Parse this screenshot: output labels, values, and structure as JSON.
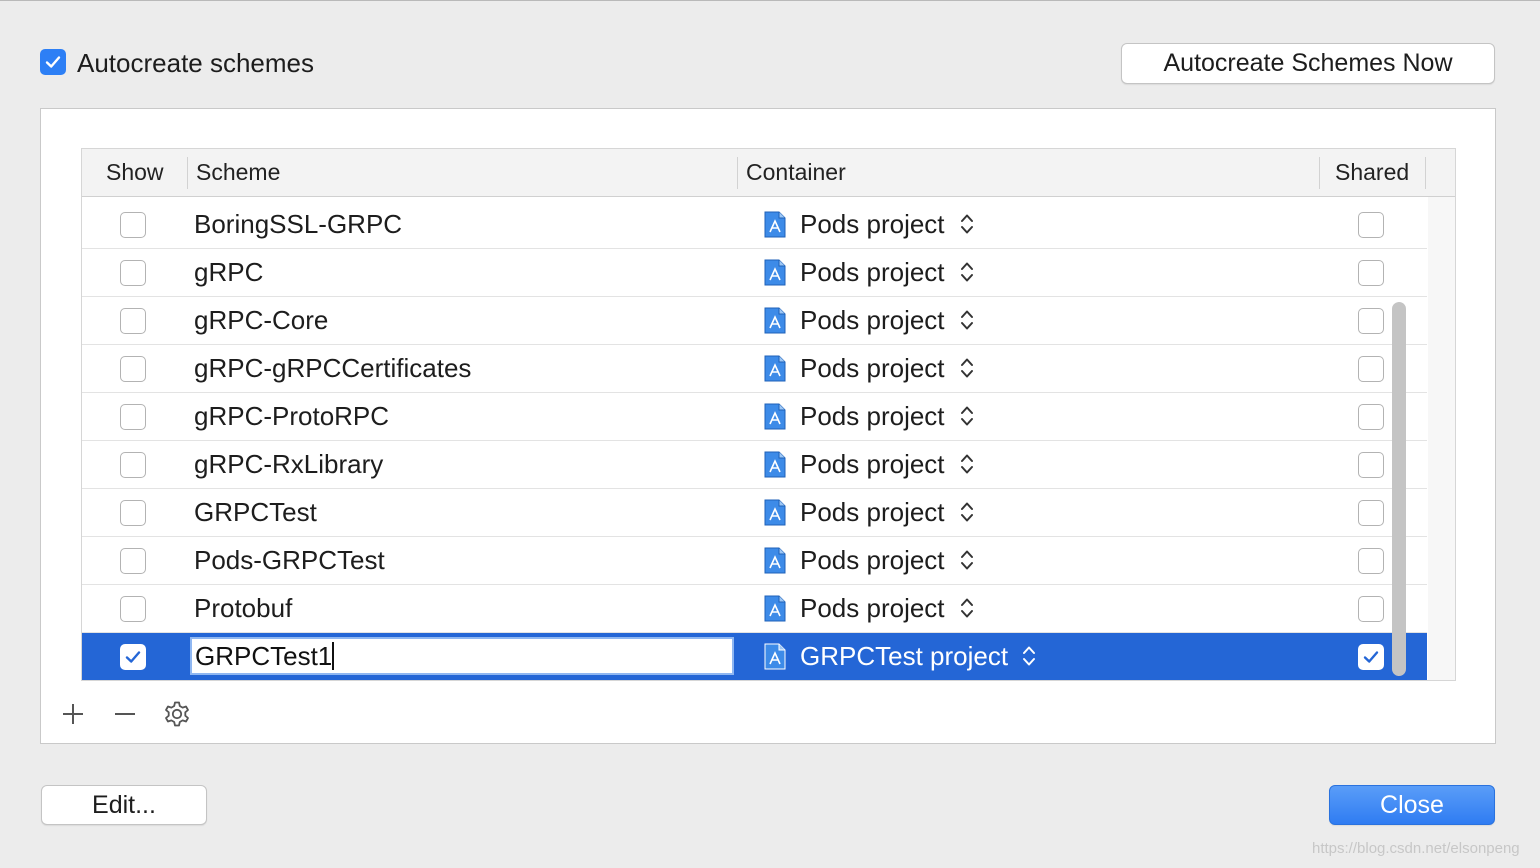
{
  "autocreate": {
    "label": "Autocreate schemes",
    "checked": true
  },
  "buttons": {
    "autocreate_now": "Autocreate Schemes Now",
    "edit": "Edit...",
    "close": "Close"
  },
  "table": {
    "columns": [
      "Show",
      "Scheme",
      "Container",
      "Shared"
    ],
    "rows": [
      {
        "show": false,
        "scheme": "BoringSSL-GRPC",
        "container": "Pods project",
        "shared": false
      },
      {
        "show": false,
        "scheme": "gRPC",
        "container": "Pods project",
        "shared": false
      },
      {
        "show": false,
        "scheme": "gRPC-Core",
        "container": "Pods project",
        "shared": false
      },
      {
        "show": false,
        "scheme": "gRPC-gRPCCertificates",
        "container": "Pods project",
        "shared": false
      },
      {
        "show": false,
        "scheme": "gRPC-ProtoRPC",
        "container": "Pods project",
        "shared": false
      },
      {
        "show": false,
        "scheme": "gRPC-RxLibrary",
        "container": "Pods project",
        "shared": false
      },
      {
        "show": false,
        "scheme": "GRPCTest",
        "container": "Pods project",
        "shared": false
      },
      {
        "show": false,
        "scheme": "Pods-GRPCTest",
        "container": "Pods project",
        "shared": false
      },
      {
        "show": false,
        "scheme": "Protobuf",
        "container": "Pods project",
        "shared": false
      },
      {
        "show": true,
        "scheme": "GRPCTest1",
        "container": "GRPCTest project",
        "shared": true,
        "selected": true,
        "editing": true
      }
    ]
  },
  "toolbar": {
    "icons": [
      "plus-icon",
      "minus-icon",
      "gear-icon"
    ]
  },
  "watermark": "https://blog.csdn.net/elsonpeng",
  "colors": {
    "accent": "#2d7ff5",
    "selection": "#2466d6",
    "close_button": "#2f7cf2"
  }
}
